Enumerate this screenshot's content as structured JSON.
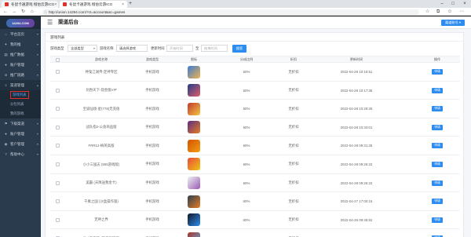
{
  "browser": {
    "tabs": [
      {
        "title": "冬鼠卡通游戏 橙伯云游ICG",
        "active": false
      },
      {
        "title": "冬鼠卡通游戏 橙伯云游ICG",
        "active": true
      }
    ],
    "url": "http://union.14294.com/?ct=account&ac=games",
    "favicon_colors": [
      "#e0302b",
      "#e0302b"
    ]
  },
  "sidebar": {
    "logo_text": "14294.COM",
    "items": [
      {
        "label": "平台首页",
        "icon": "home-icon",
        "glyph": "⌂",
        "expanded": false
      },
      {
        "label": "我的推",
        "icon": "share-icon",
        "glyph": "✦",
        "expanded": false
      },
      {
        "label": "推广数据",
        "icon": "chart-icon",
        "glyph": "▤",
        "expanded": false
      },
      {
        "label": "账户管理",
        "icon": "user-icon",
        "glyph": "●",
        "expanded": false
      },
      {
        "label": "推广链路",
        "icon": "link-icon",
        "glyph": "⊘",
        "expanded": false
      },
      {
        "label": "渠道管理",
        "icon": "channel-icon",
        "glyph": "≡",
        "expanded": true
      }
    ],
    "subitems": [
      {
        "label": "游戏列表",
        "active": true
      },
      {
        "label": "分包列表",
        "active": false
      },
      {
        "label": "我的游戏",
        "active": false
      }
    ],
    "items_after": [
      {
        "label": "下级渠道",
        "icon": "sub-channel-icon",
        "glyph": "⚑"
      },
      {
        "label": "账户管理",
        "icon": "account-icon",
        "glyph": "●"
      },
      {
        "label": "客户管理",
        "icon": "customer-icon",
        "glyph": "◉"
      },
      {
        "label": "帮助中心",
        "icon": "help-icon",
        "glyph": "?"
      }
    ]
  },
  "header": {
    "title": "渠道后台",
    "account_button": "渠道账号 ▾"
  },
  "panel": {
    "title": "游戏列表"
  },
  "filters": {
    "game_type_label": "游戏类型",
    "game_type_value": "全部类型",
    "game_name_label": "游戏名称",
    "game_name_value": "请选择游戏",
    "time_label": "更新时间",
    "start_placeholder": "开始时间",
    "to_label": "至",
    "end_placeholder": "结束时间",
    "search_button": "搜索"
  },
  "table": {
    "headers": [
      "",
      "游戏名称",
      "游戏类型",
      "图标",
      "分成比例",
      "折扣",
      "更新时间",
      "操作"
    ],
    "rows": [
      {
        "name": "神鬼江湖传-定神专区",
        "type": "手机游戏",
        "share": "60%",
        "discount": "无折扣",
        "time": "2022-04-28 10:15:51",
        "op": "申请",
        "icon_colors": [
          "#3a7bd5",
          "#f0b44c"
        ]
      },
      {
        "name": "剑吞天下-现金版VIP",
        "type": "手机游戏",
        "share": "60%",
        "discount": "无折扣",
        "time": "2022-04-28 10:17:36",
        "op": "申请",
        "icon_colors": [
          "#1f3c88",
          "#e35d6a"
        ]
      },
      {
        "name": "至诚仙境-星(778)无充值",
        "type": "手机游戏",
        "share": "50%",
        "discount": "无折扣",
        "time": "2022-04-28 10:29:25",
        "op": "申请",
        "icon_colors": [
          "#c0392b",
          "#f5c542"
        ]
      },
      {
        "name": "战队指2-公会商品版",
        "type": "手机游戏",
        "share": "60%",
        "discount": "无折扣",
        "time": "2022-04-28 10:32:01",
        "op": "申请",
        "icon_colors": [
          "#5b2c83",
          "#e67e22"
        ]
      },
      {
        "name": "FRR12-梅英高版",
        "type": "手机游戏",
        "share": "60%",
        "discount": "无折扣",
        "time": "2022-04-28 09:31:25",
        "op": "申请",
        "icon_colors": [
          "#d35400",
          "#f39c12"
        ]
      },
      {
        "name": "小小三国志 (555游戏版)",
        "type": "手机游戏",
        "share": "60%",
        "discount": "无折扣",
        "time": "2022-04-28 09:26:22",
        "op": "申请",
        "icon_colors": [
          "#e74c3c",
          "#f1c40f"
        ]
      },
      {
        "name": "美霸 (天降送我金卡)",
        "type": "手机游戏",
        "share": "60%",
        "discount": "无折扣",
        "time": "2022-04-28 09:26:22",
        "op": "申请",
        "icon_colors": [
          "#ecf0f1",
          "#9b59b6"
        ]
      },
      {
        "name": "千乘之国 (沙盒操作版)",
        "type": "手机游戏",
        "share": "60%",
        "discount": "无折扣",
        "time": "2022-04-27 17:00:15",
        "op": "申请",
        "icon_colors": [
          "#2c3e50",
          "#e67e22"
        ]
      },
      {
        "name": "无神之界",
        "type": "手机游戏",
        "share": "60%",
        "discount": "无折扣",
        "time": "2022-04-26 09:45:52",
        "op": "申请",
        "icon_colors": [
          "#111827",
          "#2d8cf0"
        ]
      },
      {
        "name": "战斗天使萌 (天使剧情版)",
        "type": "手机游戏",
        "share": "60%",
        "discount": "无折扣",
        "time": "2022-04-26 09:17:30",
        "op": "申请",
        "icon_colors": [
          "#a93226",
          "#5dade2"
        ]
      }
    ]
  },
  "colors": {
    "accent": "#2d8cf0",
    "sidebar": "#2b3b4e",
    "highlight_border": "#e0302b"
  }
}
